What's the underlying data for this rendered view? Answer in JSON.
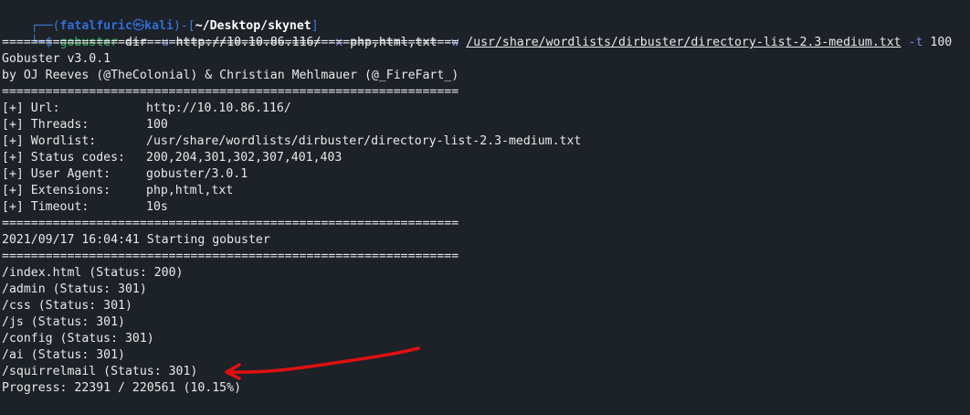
{
  "prompt": {
    "corner_top": "┌──(",
    "user": "fatalfuric",
    "at_symbol": "㉿",
    "host": "kali",
    "mid": ")-[",
    "cwd": "~/Desktop/skynet",
    "end": "]",
    "corner_bottom": "└─",
    "dollar": "$ "
  },
  "command": {
    "tool": "gobuster",
    "mode": " dir ",
    "flag_u": "-u",
    "url": " http://10.10.86.116/ ",
    "flag_x": "-x",
    "exts": " php,html,txt ",
    "flag_w": "-w",
    "wordlist": "/usr/share/wordlists/dirbuster/directory-list-2.3-medium.txt",
    "flag_t": " -t",
    "threads": " 100"
  },
  "separator": "===============================================================",
  "banner": {
    "version": "Gobuster v3.0.1",
    "authors": "by OJ Reeves (@TheColonial) & Christian Mehlmauer (@_FireFart_)"
  },
  "config": [
    {
      "key": "[+] Url:",
      "value": "http://10.10.86.116/"
    },
    {
      "key": "[+] Threads:",
      "value": "100"
    },
    {
      "key": "[+] Wordlist:",
      "value": "/usr/share/wordlists/dirbuster/directory-list-2.3-medium.txt"
    },
    {
      "key": "[+] Status codes:",
      "value": "200,204,301,302,307,401,403"
    },
    {
      "key": "[+] User Agent:",
      "value": "gobuster/3.0.1"
    },
    {
      "key": "[+] Extensions:",
      "value": "php,html,txt"
    },
    {
      "key": "[+] Timeout:",
      "value": "10s"
    }
  ],
  "start_line": "2021/09/17 16:04:41 Starting gobuster",
  "results": [
    "/index.html (Status: 200)",
    "/admin (Status: 301)",
    "/css (Status: 301)",
    "/js (Status: 301)",
    "/config (Status: 301)",
    "/ai (Status: 301)",
    "/squirrelmail (Status: 301)"
  ],
  "progress": "Progress: 22391 / 220561 (10.15%)",
  "colors": {
    "background": "#1d2128",
    "prompt_blue": "#3d7bd6",
    "command_green": "#2fb85b",
    "flag_purple": "#7b84e8",
    "annotation_red": "#e01010"
  }
}
